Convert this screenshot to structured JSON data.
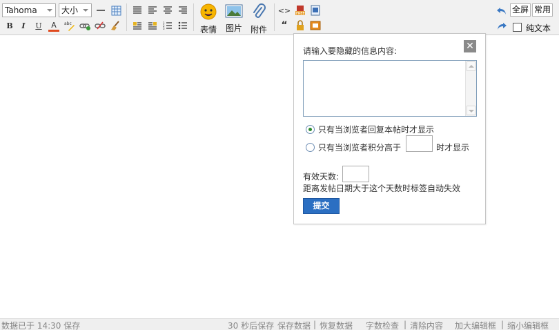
{
  "toolbar": {
    "font_family": "Tahoma",
    "font_size": "大小",
    "emoticon_label": "表情",
    "image_label": "图片",
    "attachment_label": "附件",
    "fullscreen_label": "全屏",
    "common_label": "常用",
    "plain_text_label": "纯文本",
    "bold": "B",
    "italic": "I",
    "underline": "U",
    "font_color": "A",
    "quote": "“",
    "code": "<>"
  },
  "popup": {
    "prompt": "请输入要隐藏的信息内容:",
    "close_glyph": "✕",
    "option_reply": "只有当浏览者回复本帖时才显示",
    "option_points_prefix": "只有当浏览者积分高于",
    "option_points_suffix": "时才显示",
    "days_label": "有效天数:",
    "days_note": "距离发帖日期大于这个天数时标签自动失效",
    "submit_label": "提交",
    "selected_option": "reply"
  },
  "status": {
    "saved": "数据已于 14:30 保存",
    "countdown": "30 秒后保存",
    "save_data": "保存数据",
    "restore_data": "恢复数据",
    "word_count": "字数检查",
    "clear_content": "清除内容",
    "enlarge_editor": "加大编辑框",
    "shrink_editor": "缩小编辑框"
  },
  "colors": {
    "submit_bg": "#2b6fc2",
    "radio_on": "#2c8a2c",
    "toolbar_bg": "#f1f1f1"
  }
}
